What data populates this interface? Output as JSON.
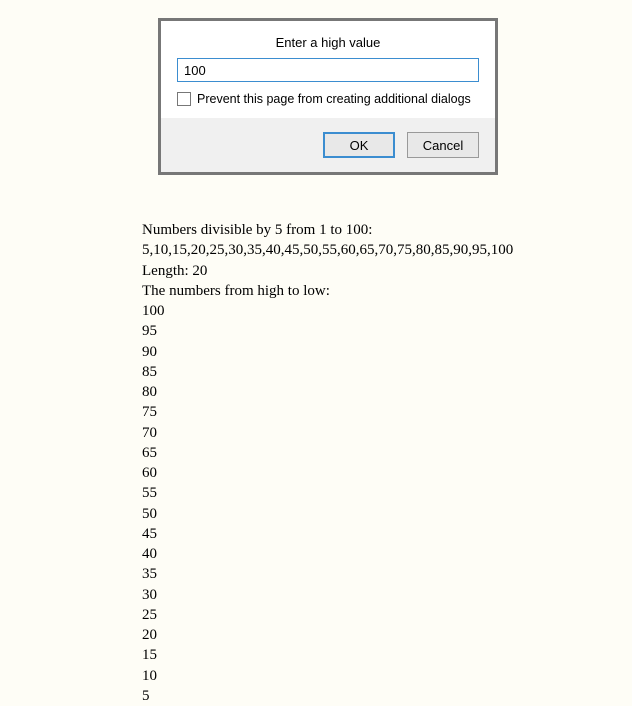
{
  "dialog": {
    "title": "Enter a high value",
    "input_value": "100",
    "checkbox_label": "Prevent this page from creating additional dialogs",
    "ok_label": "OK",
    "cancel_label": "Cancel"
  },
  "output": {
    "line1": "Numbers divisible by 5 from 1 to 100:",
    "line2": "5,10,15,20,25,30,35,40,45,50,55,60,65,70,75,80,85,90,95,100",
    "line3": "Length: 20",
    "line4": "The numbers from high to low:",
    "numbers": [
      "100",
      "95",
      "90",
      "85",
      "80",
      "75",
      "70",
      "65",
      "60",
      "55",
      "50",
      "45",
      "40",
      "35",
      "30",
      "25",
      "20",
      "15",
      "10",
      "5"
    ]
  }
}
